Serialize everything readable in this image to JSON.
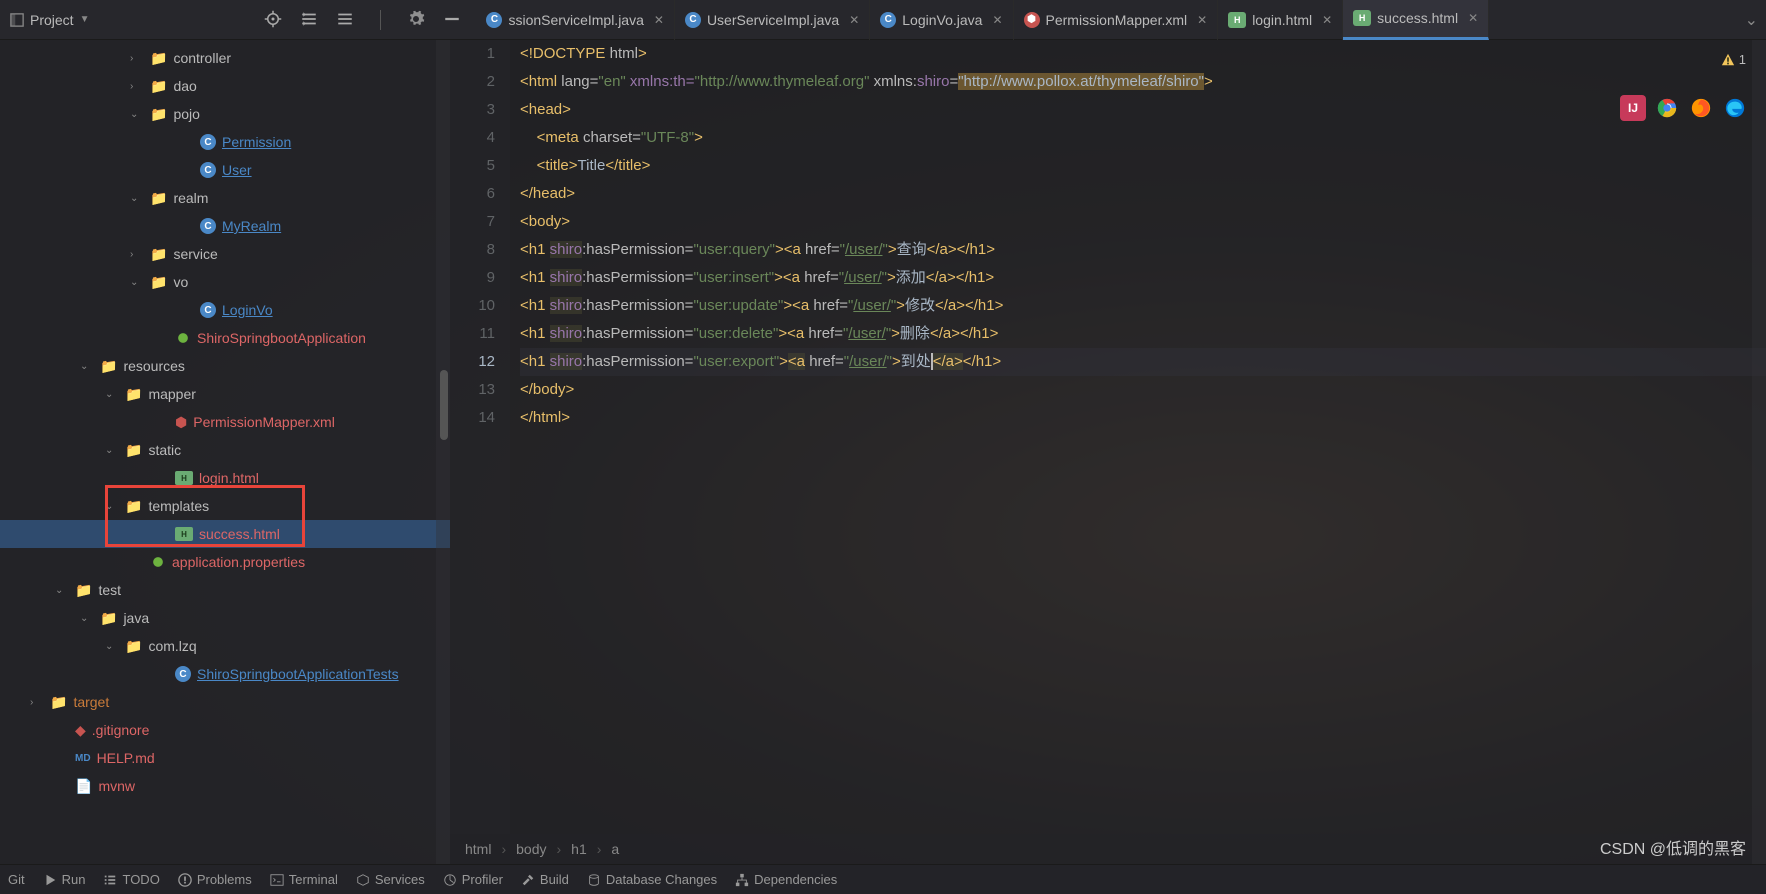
{
  "topbar": {
    "project_label": "Project"
  },
  "tabs": [
    {
      "name": "ssionServiceImpl.java",
      "type": "java",
      "active": false
    },
    {
      "name": "UserServiceImpl.java",
      "type": "java",
      "active": false
    },
    {
      "name": "LoginVo.java",
      "type": "java",
      "active": false
    },
    {
      "name": "PermissionMapper.xml",
      "type": "xml",
      "active": false
    },
    {
      "name": "login.html",
      "type": "html",
      "active": false
    },
    {
      "name": "success.html",
      "type": "html",
      "active": true
    }
  ],
  "tree": [
    {
      "indent": 130,
      "arrow": "›",
      "icon": "folder",
      "label": "controller"
    },
    {
      "indent": 130,
      "arrow": "›",
      "icon": "folder",
      "label": "dao"
    },
    {
      "indent": 130,
      "arrow": "⌄",
      "icon": "folder",
      "label": "pojo"
    },
    {
      "indent": 180,
      "arrow": "",
      "icon": "class",
      "label": "Permission",
      "link": true
    },
    {
      "indent": 180,
      "arrow": "",
      "icon": "class",
      "label": "User",
      "link": true
    },
    {
      "indent": 130,
      "arrow": "⌄",
      "icon": "folder",
      "label": "realm"
    },
    {
      "indent": 180,
      "arrow": "",
      "icon": "class",
      "label": "MyRealm",
      "link": true
    },
    {
      "indent": 130,
      "arrow": "›",
      "icon": "folder",
      "label": "service"
    },
    {
      "indent": 130,
      "arrow": "⌄",
      "icon": "folder",
      "label": "vo"
    },
    {
      "indent": 180,
      "arrow": "",
      "icon": "class",
      "label": "LoginVo",
      "link": true
    },
    {
      "indent": 155,
      "arrow": "",
      "icon": "spring",
      "label": "ShiroSpringbootApplication",
      "red": true
    },
    {
      "indent": 80,
      "arrow": "⌄",
      "icon": "folder-blue",
      "label": "resources"
    },
    {
      "indent": 105,
      "arrow": "⌄",
      "icon": "folder",
      "label": "mapper"
    },
    {
      "indent": 155,
      "arrow": "",
      "icon": "xml",
      "label": "PermissionMapper.xml",
      "red": true
    },
    {
      "indent": 105,
      "arrow": "⌄",
      "icon": "folder",
      "label": "static"
    },
    {
      "indent": 155,
      "arrow": "",
      "icon": "html",
      "label": "login.html",
      "red": true
    },
    {
      "indent": 105,
      "arrow": "⌄",
      "icon": "folder",
      "label": "templates"
    },
    {
      "indent": 155,
      "arrow": "",
      "icon": "html",
      "label": "success.html",
      "selected": true,
      "red": true
    },
    {
      "indent": 130,
      "arrow": "",
      "icon": "spring",
      "label": "application.properties",
      "red": true
    },
    {
      "indent": 55,
      "arrow": "⌄",
      "icon": "folder-blue",
      "label": "test"
    },
    {
      "indent": 80,
      "arrow": "⌄",
      "icon": "folder-green",
      "label": "java"
    },
    {
      "indent": 105,
      "arrow": "⌄",
      "icon": "folder",
      "label": "com.lzq"
    },
    {
      "indent": 155,
      "arrow": "",
      "icon": "class",
      "label": "ShiroSpringbootApplicationTests",
      "link": true
    },
    {
      "indent": 30,
      "arrow": "›",
      "icon": "folder-orange",
      "label": "target",
      "orange": true
    },
    {
      "indent": 55,
      "arrow": "",
      "icon": "git",
      "label": ".gitignore",
      "red": true
    },
    {
      "indent": 55,
      "arrow": "",
      "icon": "md",
      "label": "HELP.md",
      "red": true
    },
    {
      "indent": 55,
      "arrow": "",
      "icon": "file",
      "label": "mvnw",
      "red": true
    }
  ],
  "warning_count": "1",
  "code_lines": [
    {
      "n": 1,
      "html": "<span class='tag'>&lt;!DOCTYPE</span> <span class='attr'>html</span><span class='tag'>&gt;</span>"
    },
    {
      "n": 2,
      "html": "<span class='tag'>&lt;html</span> <span class='attr'>lang=</span><span class='str'>\"en\"</span> <span class='ns'>xmlns:th=</span><span class='str'>\"http://www.thymeleaf.org\"</span> <span class='attr'>xmlns:</span><span class='ns'>shiro</span><span class='attr'>=</span><span class='hl2'>\"http://www.pollox.at/thymeleaf/shiro\"</span><span class='tag'>&gt;</span>"
    },
    {
      "n": 3,
      "html": "<span class='tag'>&lt;head&gt;</span>"
    },
    {
      "n": 4,
      "html": "    <span class='tag'>&lt;meta</span> <span class='attr'>charset=</span><span class='str'>\"UTF-8\"</span><span class='tag'>&gt;</span>"
    },
    {
      "n": 5,
      "html": "    <span class='tag'>&lt;title&gt;</span><span class='txt'>Title</span><span class='tag'>&lt;/title&gt;</span>"
    },
    {
      "n": 6,
      "html": "<span class='tag'>&lt;/head&gt;</span>"
    },
    {
      "n": 7,
      "html": "<span class='tag'>&lt;body&gt;</span>"
    },
    {
      "n": 8,
      "html": "<span class='tag'>&lt;h1</span> <span class='ns hl'>shiro</span><span class='attr'>:hasPermission=</span><span class='str'>\"user:query\"</span><span class='tag'>&gt;&lt;a</span> <span class='attr'>href=</span><span class='str'>\"</span><span class='url'>/user/</span><span class='str'>\"</span><span class='tag'>&gt;</span><span class='txt'>查询</span><span class='tag'>&lt;/a&gt;&lt;/h1&gt;</span>"
    },
    {
      "n": 9,
      "html": "<span class='tag'>&lt;h1</span> <span class='ns hl'>shiro</span><span class='attr'>:hasPermission=</span><span class='str'>\"user:insert\"</span><span class='tag'>&gt;&lt;a</span> <span class='attr'>href=</span><span class='str'>\"</span><span class='url'>/user/</span><span class='str'>\"</span><span class='tag'>&gt;</span><span class='txt'>添加</span><span class='tag'>&lt;/a&gt;&lt;/h1&gt;</span>"
    },
    {
      "n": 10,
      "html": "<span class='tag'>&lt;h1</span> <span class='ns hl'>shiro</span><span class='attr'>:hasPermission=</span><span class='str'>\"user:update\"</span><span class='tag'>&gt;&lt;a</span> <span class='attr'>href=</span><span class='str'>\"</span><span class='url'>/user/</span><span class='str'>\"</span><span class='tag'>&gt;</span><span class='txt'>修改</span><span class='tag'>&lt;/a&gt;&lt;/h1&gt;</span>"
    },
    {
      "n": 11,
      "html": "<span class='tag'>&lt;h1</span> <span class='ns hl'>shiro</span><span class='attr'>:hasPermission=</span><span class='str'>\"user:delete\"</span><span class='tag'>&gt;&lt;a</span> <span class='attr'>href=</span><span class='str'>\"</span><span class='url'>/user/</span><span class='str'>\"</span><span class='tag'>&gt;</span><span class='txt'>删除</span><span class='tag'>&lt;/a&gt;&lt;/h1&gt;</span>"
    },
    {
      "n": 12,
      "current": true,
      "html": "<span class='tag'>&lt;h1</span> <span class='ns hl'>shiro</span><span class='attr'>:hasPermission=</span><span class='str'>\"user:export\"</span><span class='tag'>&gt;<span class='hl'>&lt;a</span></span> <span class='attr'>href=</span><span class='str'>\"</span><span class='url'>/user/</span><span class='str'>\"</span><span class='tag'>&gt;</span><span class='txt'>到处<span class='caret'></span></span><span class='tag hl'>&lt;/a&gt;</span><span class='tag'>&lt;/h1&gt;</span>"
    },
    {
      "n": 13,
      "html": "<span class='tag'>&lt;/body&gt;</span>"
    },
    {
      "n": 14,
      "html": "<span class='tag'>&lt;/html&gt;</span>"
    }
  ],
  "breadcrumb": [
    "html",
    "body",
    "h1",
    "a"
  ],
  "bottom": {
    "git": "Git",
    "run": "Run",
    "todo": "TODO",
    "problems": "Problems",
    "terminal": "Terminal",
    "services": "Services",
    "profiler": "Profiler",
    "build": "Build",
    "db_changes": "Database Changes",
    "dependencies": "Dependencies"
  },
  "watermark": "CSDN @低调的黑客"
}
